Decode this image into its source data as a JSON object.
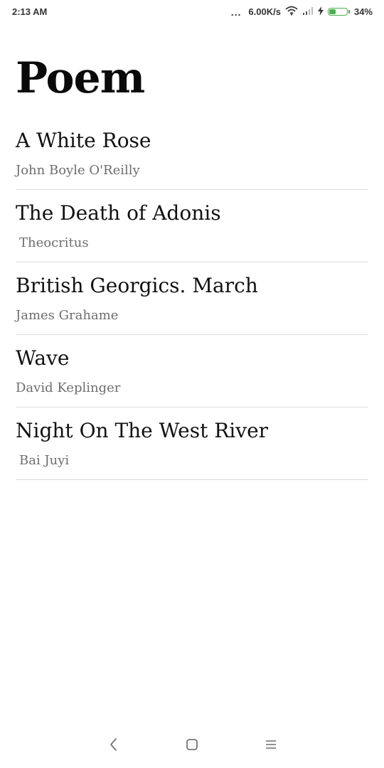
{
  "status_bar": {
    "time": "2:13 AM",
    "dots": "...",
    "network_speed": "6.00K/s",
    "battery_percent": "34%",
    "icons": [
      "wifi-icon",
      "signal-icon",
      "charging-icon",
      "battery-icon"
    ]
  },
  "header": {
    "title": "Poem"
  },
  "poems": [
    {
      "title": "A White Rose",
      "author": "John Boyle O'Reilly"
    },
    {
      "title": "The Death of Adonis",
      "author": "Theocritus"
    },
    {
      "title": "British Georgics. March",
      "author": "James Grahame"
    },
    {
      "title": "Wave",
      "author": "David Keplinger"
    },
    {
      "title": "Night On The West River",
      "author": "Bai Juyi"
    }
  ],
  "nav_bar": {
    "icons": [
      "back-icon",
      "home-icon",
      "menu-icon"
    ]
  },
  "colors": {
    "background": "#ffffff",
    "title": "#0a0a0a",
    "author": "#6e6e6e",
    "divider": "#dcdcdc",
    "battery": "#4caf50"
  }
}
